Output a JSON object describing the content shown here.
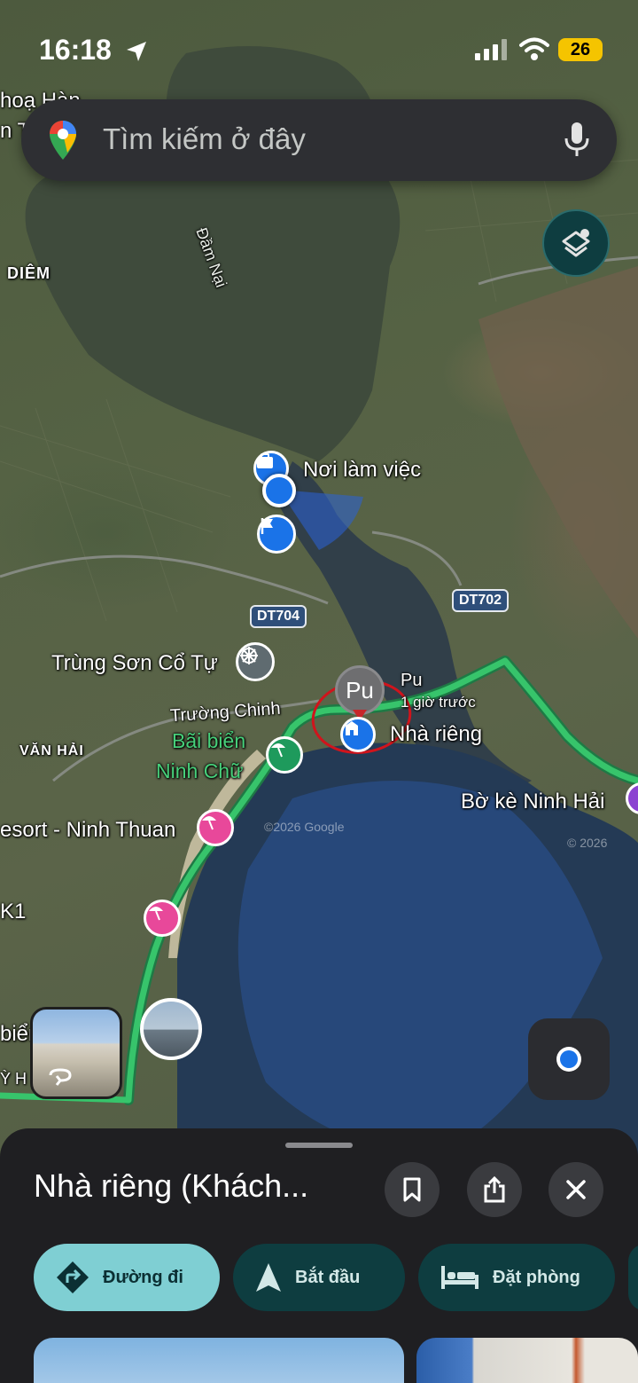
{
  "status_bar": {
    "time": "16:18",
    "battery": "26"
  },
  "search": {
    "placeholder": "Tìm kiếm ở đây"
  },
  "map": {
    "labels": {
      "dam_nai": "Đầm Nại",
      "diem": "DIÊM",
      "hoa_han": "hoạ Hàn",
      "top_left_fragment": "n T",
      "noi_lam_viec": "Nơi làm việc",
      "trung_son": "Trùng Sơn Cổ Tự",
      "pu_badge": "Pu",
      "pu_name": "Pu",
      "pu_time": "1 giờ trước",
      "nha_rieng": "Nhà riêng",
      "truong_chinh": "Trường Chinh",
      "bai_bien_line1": "Bãi biển",
      "bai_bien_line2": "Ninh Chữ",
      "van_hai": "VĂN HẢI",
      "resort": "esort - Ninh Thuan",
      "bo_ke": "Bờ kè Ninh Hải",
      "k1": "K1",
      "bien": "biển",
      "y_h": "Ỳ H",
      "copyright": "©2026 Google",
      "copyright2": "© 2026"
    },
    "roads": {
      "dt704": "DT704",
      "dt702": "DT702"
    }
  },
  "sheet": {
    "title": "Nhà riêng (Khách...",
    "actions": [
      {
        "label": "Đường đi",
        "icon": "directions-icon"
      },
      {
        "label": "Bắt đầu",
        "icon": "navigation-arrow-icon"
      },
      {
        "label": "Đặt phòng",
        "icon": "bed-icon"
      }
    ]
  },
  "colors": {
    "accent_teal": "#7fcfd3",
    "chip_dark_teal": "#0e3d40",
    "route_green": "#37c46b",
    "pin_blue": "#1a73e8",
    "pin_pink": "#e8489a",
    "pin_green": "#1e9a5c",
    "battery_yellow": "#f5c400"
  }
}
